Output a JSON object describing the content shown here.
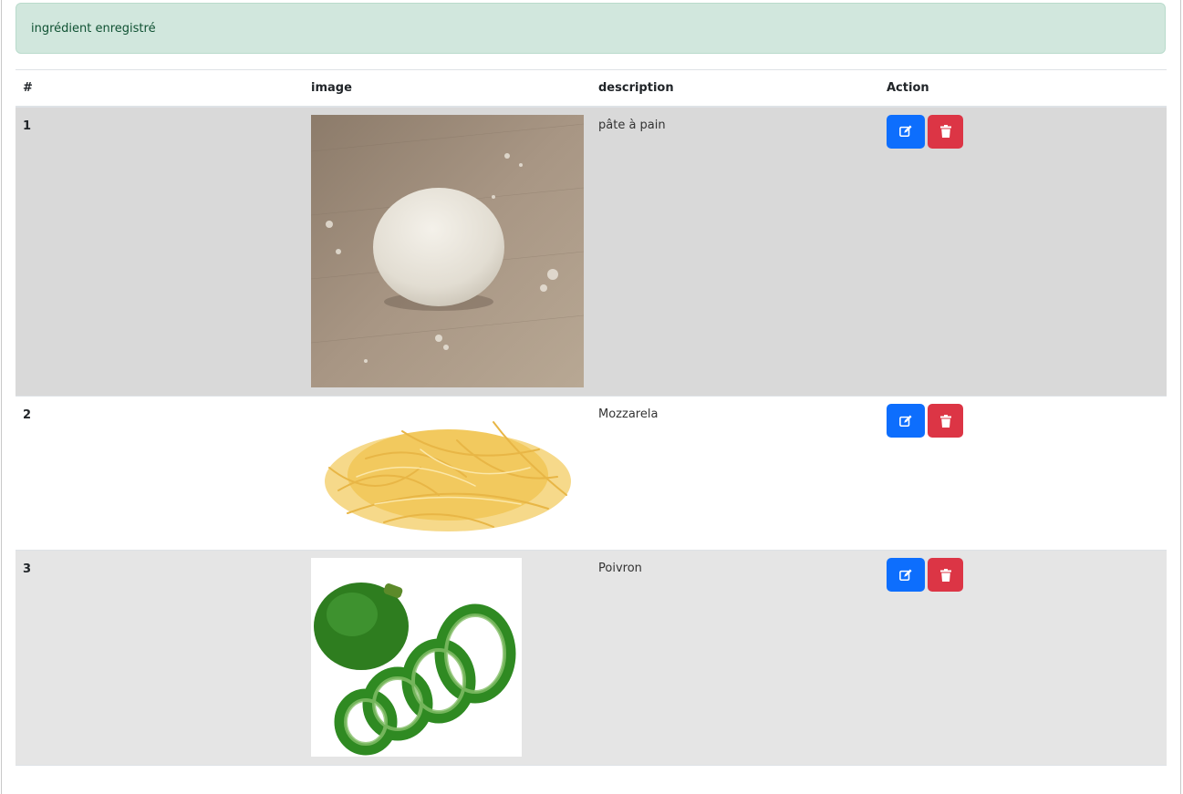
{
  "alert": {
    "message": "ingrédient enregistré"
  },
  "table": {
    "headers": [
      "#",
      "image",
      "description",
      "Action"
    ],
    "rows": [
      {
        "index": "1",
        "image_icon": "dough-ball-photo",
        "description": "pâte à pain"
      },
      {
        "index": "2",
        "image_icon": "shredded-cheese-photo",
        "description": "Mozzarela"
      },
      {
        "index": "3",
        "image_icon": "green-pepper-photo",
        "description": "Poivron"
      }
    ]
  },
  "colors": {
    "edit_button": "#0d6efd",
    "delete_button": "#dc3545",
    "alert_bg": "#d1e7dd",
    "alert_text": "#0f5132"
  },
  "icons": {
    "edit": "pencil-square-icon",
    "delete": "trash-icon"
  }
}
